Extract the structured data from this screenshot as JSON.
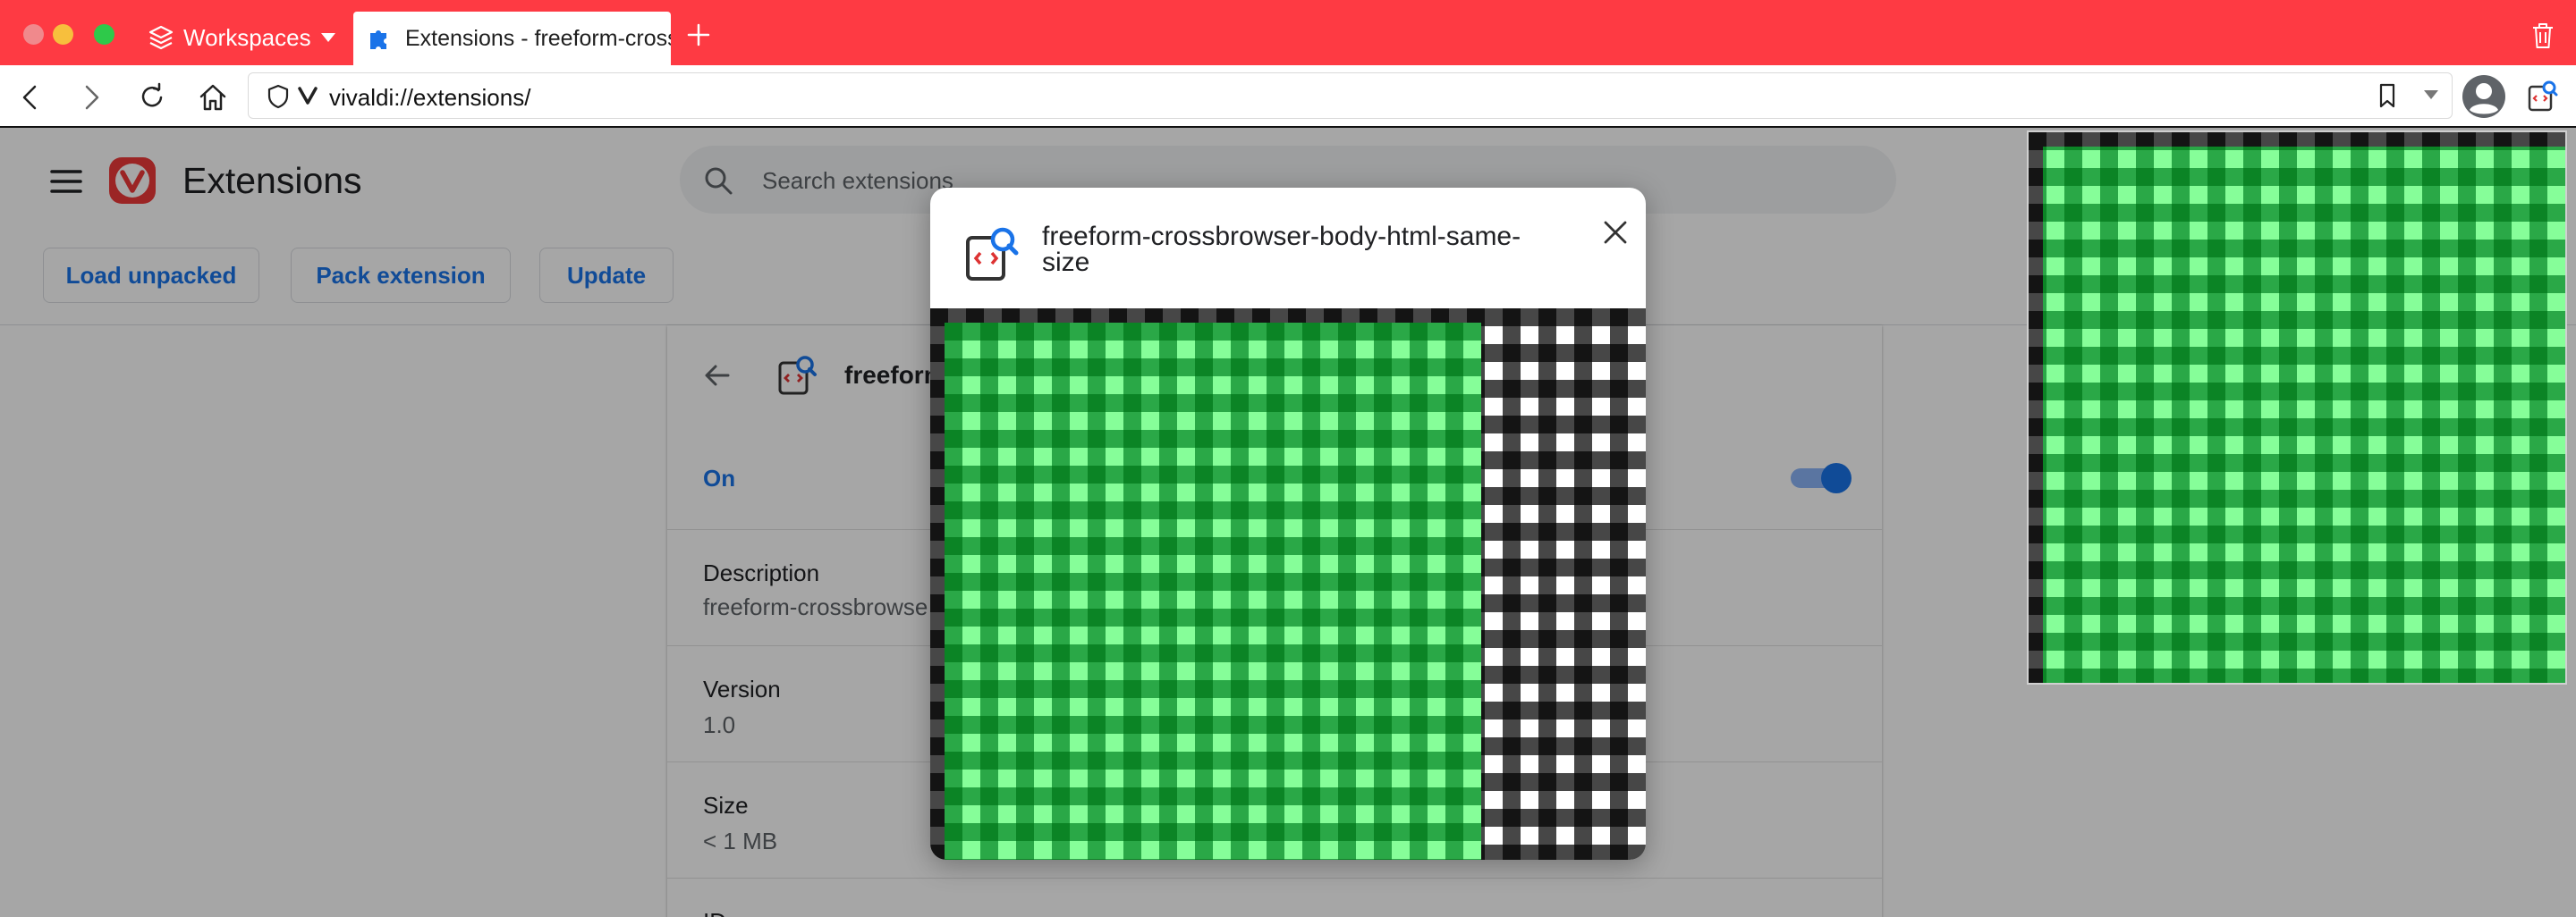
{
  "browser": {
    "workspaces_label": "Workspaces",
    "active_tab_title": "Extensions - freeform-crossbrowser-body-html-same-size",
    "url": "vivaldi://extensions/"
  },
  "extensions_page": {
    "title": "Extensions",
    "search_placeholder": "Search extensions",
    "toolbar": {
      "load_unpacked": "Load unpacked",
      "pack_extension": "Pack extension",
      "update": "Update"
    },
    "detail": {
      "name_visible": "freeform",
      "status": "On",
      "sections": {
        "description_label": "Description",
        "description_value": "freeform-crossbrowse",
        "version_label": "Version",
        "version_value": "1.0",
        "size_label": "Size",
        "size_value": "< 1 MB",
        "id_label": "ID"
      }
    }
  },
  "modal": {
    "title": "freeform-crossbrowser-body-html-same-size"
  },
  "colors": {
    "tab_strip": "#fe3a43",
    "accent": "#1a73e8",
    "green_light": "#86fe99",
    "green_mid": "#2aa847",
    "green_dark": "#0b8425"
  }
}
